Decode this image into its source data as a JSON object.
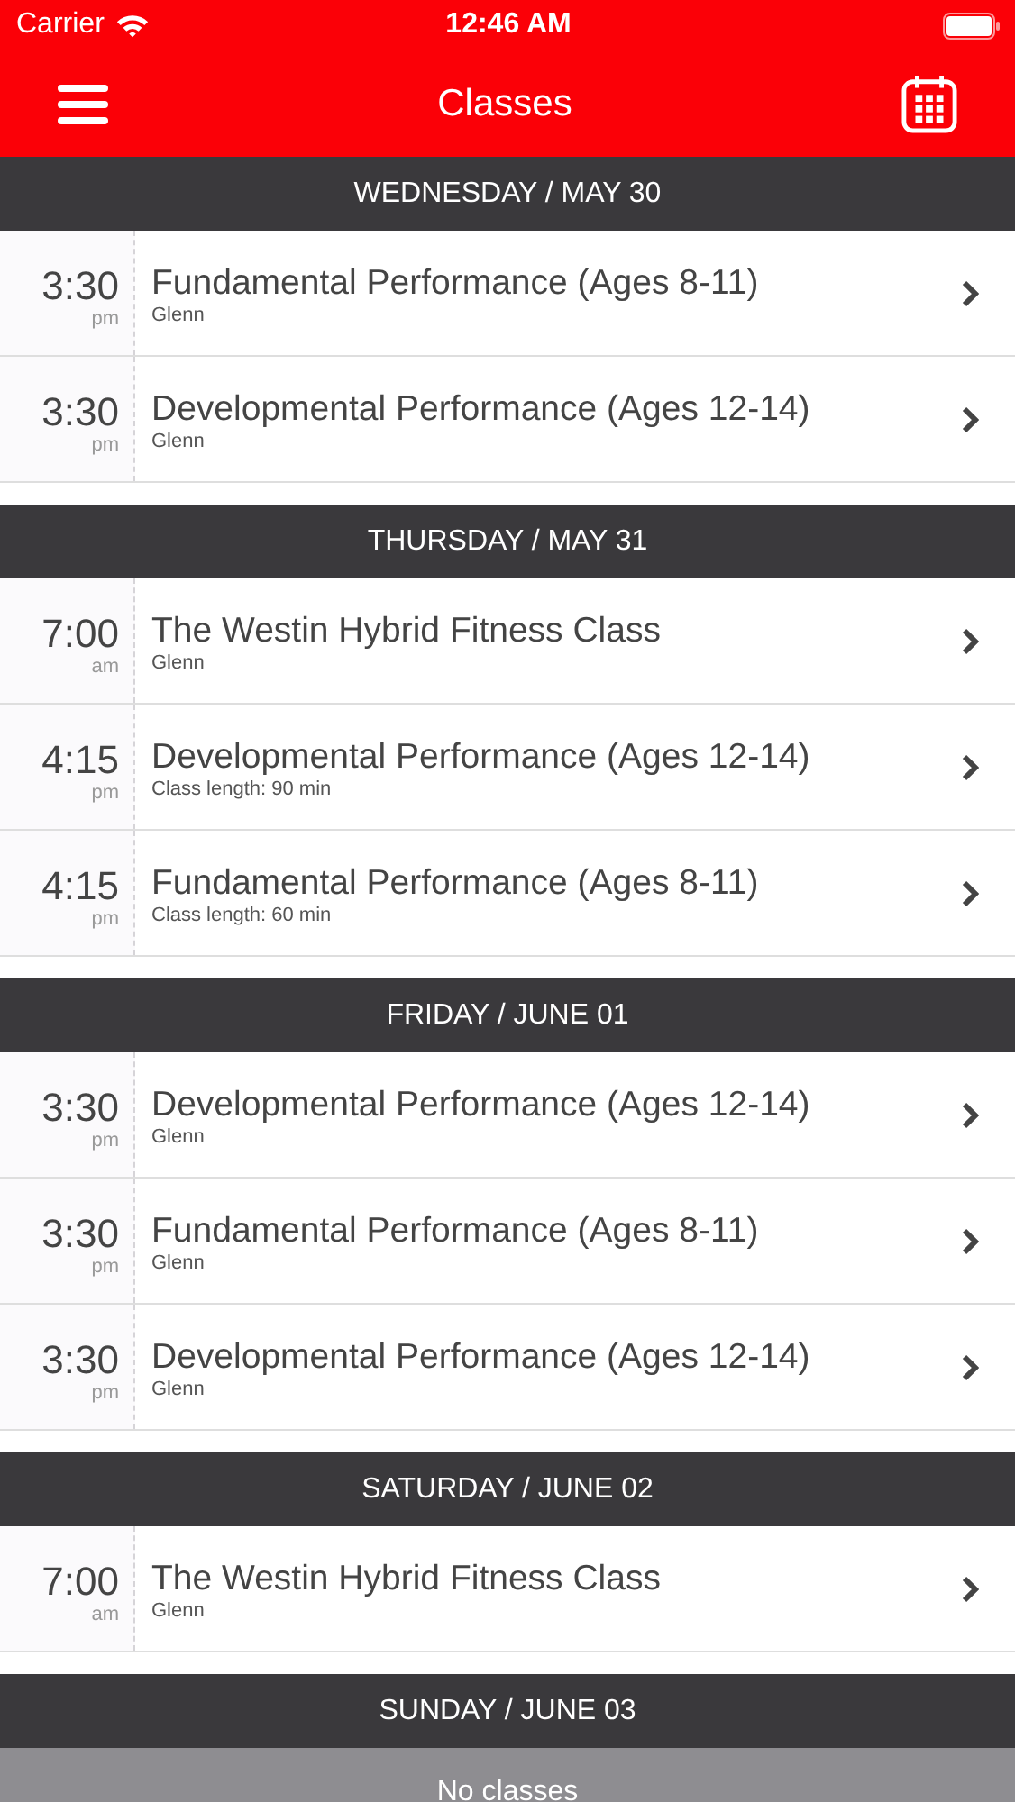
{
  "status_bar": {
    "carrier": "Carrier",
    "time": "12:46 AM"
  },
  "nav": {
    "title": "Classes"
  },
  "days": [
    {
      "heading": "WEDNESDAY / MAY 30",
      "classes": [
        {
          "time": "3:30",
          "period": "pm",
          "name": "Fundamental Performance (Ages 8-11)",
          "detail": "Glenn"
        },
        {
          "time": "3:30",
          "period": "pm",
          "name": "Developmental Performance (Ages 12-14)",
          "detail": "Glenn"
        }
      ]
    },
    {
      "heading": "THURSDAY / MAY 31",
      "classes": [
        {
          "time": "7:00",
          "period": "am",
          "name": "The Westin Hybrid Fitness Class",
          "detail": "Glenn"
        },
        {
          "time": "4:15",
          "period": "pm",
          "name": "Developmental Performance (Ages 12-14)",
          "detail": "Class length: 90 min"
        },
        {
          "time": "4:15",
          "period": "pm",
          "name": "Fundamental Performance (Ages 8-11)",
          "detail": "Class length: 60 min"
        }
      ]
    },
    {
      "heading": "FRIDAY / JUNE 01",
      "classes": [
        {
          "time": "3:30",
          "period": "pm",
          "name": "Developmental Performance (Ages 12-14)",
          "detail": "Glenn"
        },
        {
          "time": "3:30",
          "period": "pm",
          "name": "Fundamental Performance (Ages 8-11)",
          "detail": "Glenn"
        },
        {
          "time": "3:30",
          "period": "pm",
          "name": "Developmental Performance (Ages 12-14)",
          "detail": "Glenn"
        }
      ]
    },
    {
      "heading": "SATURDAY / JUNE 02",
      "classes": [
        {
          "time": "7:00",
          "period": "am",
          "name": "The Westin Hybrid Fitness Class",
          "detail": "Glenn"
        }
      ]
    },
    {
      "heading": "SUNDAY / JUNE 03",
      "empty_message": "No classes"
    }
  ]
}
